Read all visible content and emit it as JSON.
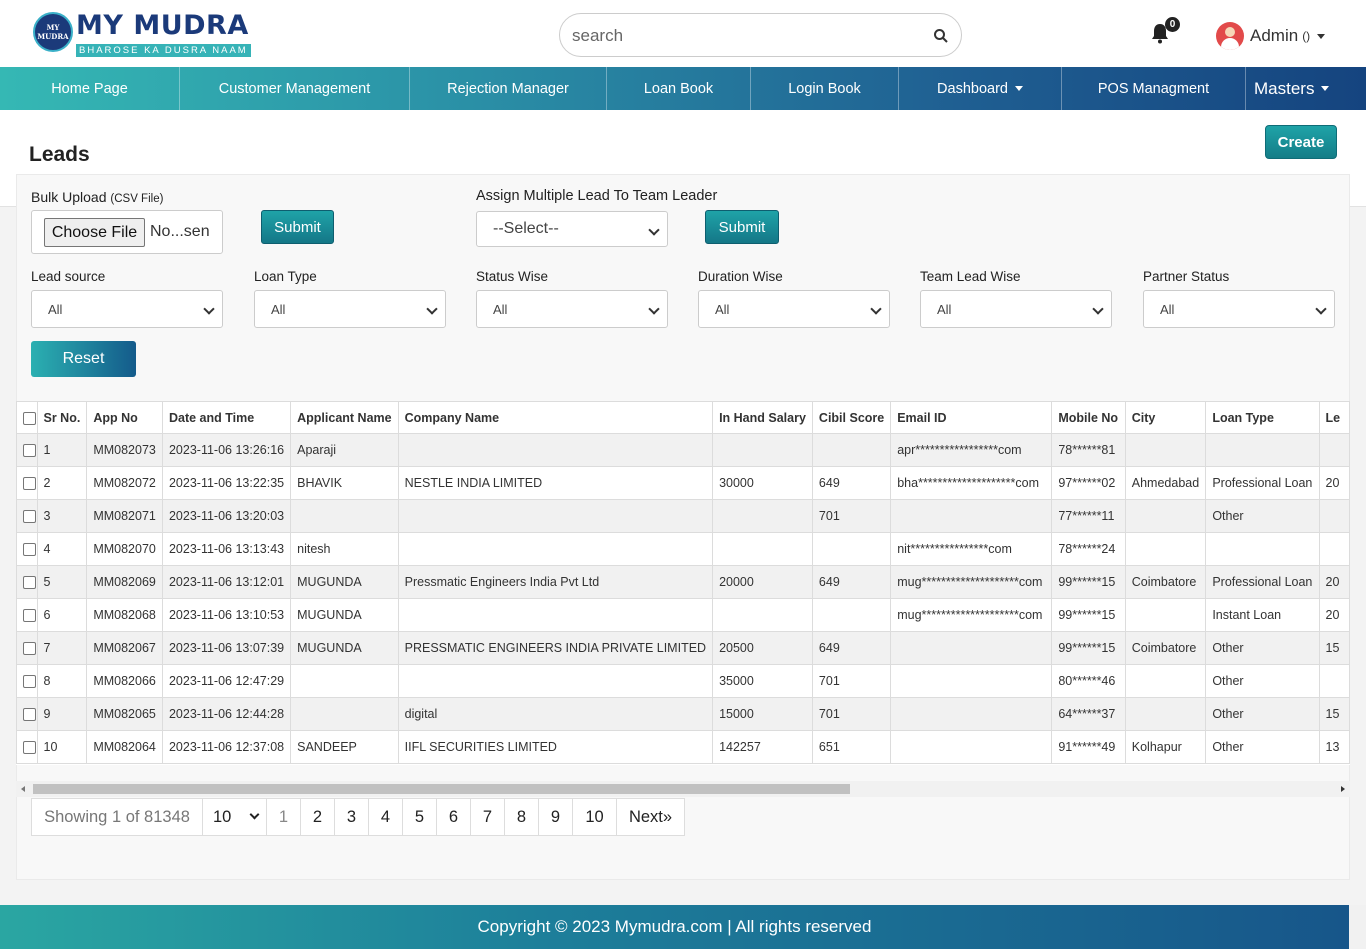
{
  "logo": {
    "badge_line1": "MY",
    "badge_line2": "MUDRA",
    "title": "MY MUDRA",
    "tagline": "BHAROSE KA DUSRA NAAM"
  },
  "search": {
    "placeholder": "search"
  },
  "notifications": {
    "count": "0"
  },
  "user": {
    "name": "Admin",
    "sub": "()"
  },
  "nav": [
    {
      "label": "Home Page"
    },
    {
      "label": "Customer Management"
    },
    {
      "label": "Rejection Manager"
    },
    {
      "label": "Loan Book"
    },
    {
      "label": "Login Book"
    },
    {
      "label": "Dashboard"
    },
    {
      "label": "POS Managment"
    },
    {
      "label": "Masters"
    }
  ],
  "page": {
    "title": "Leads",
    "create_label": "Create"
  },
  "bulk": {
    "label": "Bulk Upload",
    "hint": "(CSV File)",
    "choose_label": "Choose File",
    "file_name": "No...sen",
    "submit_label": "Submit"
  },
  "assign": {
    "label": "Assign Multiple Lead To Team Leader",
    "selected": "--Select--",
    "submit_label": "Submit"
  },
  "filters": [
    {
      "label": "Lead source",
      "value": "All"
    },
    {
      "label": "Loan Type",
      "value": "All"
    },
    {
      "label": "Status Wise",
      "value": "All"
    },
    {
      "label": "Duration Wise",
      "value": "All"
    },
    {
      "label": "Team Lead Wise",
      "value": "All"
    },
    {
      "label": "Partner Status",
      "value": "All"
    }
  ],
  "reset_label": "Reset",
  "table": {
    "headers": [
      "Sr No.",
      "App No",
      "Date and Time",
      "Applicant Name",
      "Company Name",
      "In Hand Salary",
      "Cibil Score",
      "Email ID",
      "Mobile No",
      "City",
      "Loan Type",
      "Le"
    ],
    "rows": [
      [
        "1",
        "MM082073",
        "2023-11-06 13:26:16",
        "Aparaji",
        "",
        "",
        "",
        "apr*****************com",
        "78******81",
        "",
        "",
        ""
      ],
      [
        "2",
        "MM082072",
        "2023-11-06 13:22:35",
        "BHAVIK",
        "NESTLE INDIA LIMITED",
        "30000",
        "649",
        "bha********************com",
        "97******02",
        "Ahmedabad",
        "Professional Loan",
        "20"
      ],
      [
        "3",
        "MM082071",
        "2023-11-06 13:20:03",
        "",
        "",
        "",
        "701",
        "",
        "77******11",
        "",
        "Other",
        ""
      ],
      [
        "4",
        "MM082070",
        "2023-11-06 13:13:43",
        "nitesh",
        "",
        "",
        "",
        "nit****************com",
        "78******24",
        "",
        "",
        ""
      ],
      [
        "5",
        "MM082069",
        "2023-11-06 13:12:01",
        "MUGUNDA",
        "Pressmatic Engineers India Pvt Ltd",
        "20000",
        "649",
        "mug********************com",
        "99******15",
        "Coimbatore",
        "Professional Loan",
        "20"
      ],
      [
        "6",
        "MM082068",
        "2023-11-06 13:10:53",
        "MUGUNDA",
        "",
        "",
        "",
        "mug********************com",
        "99******15",
        "",
        "Instant Loan",
        "20"
      ],
      [
        "7",
        "MM082067",
        "2023-11-06 13:07:39",
        "MUGUNDA",
        "PRESSMATIC ENGINEERS INDIA PRIVATE LIMITED",
        "20500",
        "649",
        "",
        "99******15",
        "Coimbatore",
        "Other",
        "15"
      ],
      [
        "8",
        "MM082066",
        "2023-11-06 12:47:29",
        "",
        "",
        "35000",
        "701",
        "",
        "80******46",
        "",
        "Other",
        ""
      ],
      [
        "9",
        "MM082065",
        "2023-11-06 12:44:28",
        "",
        "digital",
        "15000",
        "701",
        "",
        "64******37",
        "",
        "Other",
        "15"
      ],
      [
        "10",
        "MM082064",
        "2023-11-06 12:37:08",
        "SANDEEP",
        "IIFL SECURITIES LIMITED",
        "142257",
        "651",
        "",
        "91******49",
        "Kolhapur",
        "Other",
        "13"
      ]
    ]
  },
  "pagination": {
    "showing": "Showing 1 of 81348",
    "page_size": "10",
    "pages": [
      "1",
      "2",
      "3",
      "4",
      "5",
      "6",
      "7",
      "8",
      "9",
      "10"
    ],
    "next_label": "Next»"
  },
  "footer": {
    "text": "Copyright © 2023 Mymudra.com | All rights reserved"
  }
}
